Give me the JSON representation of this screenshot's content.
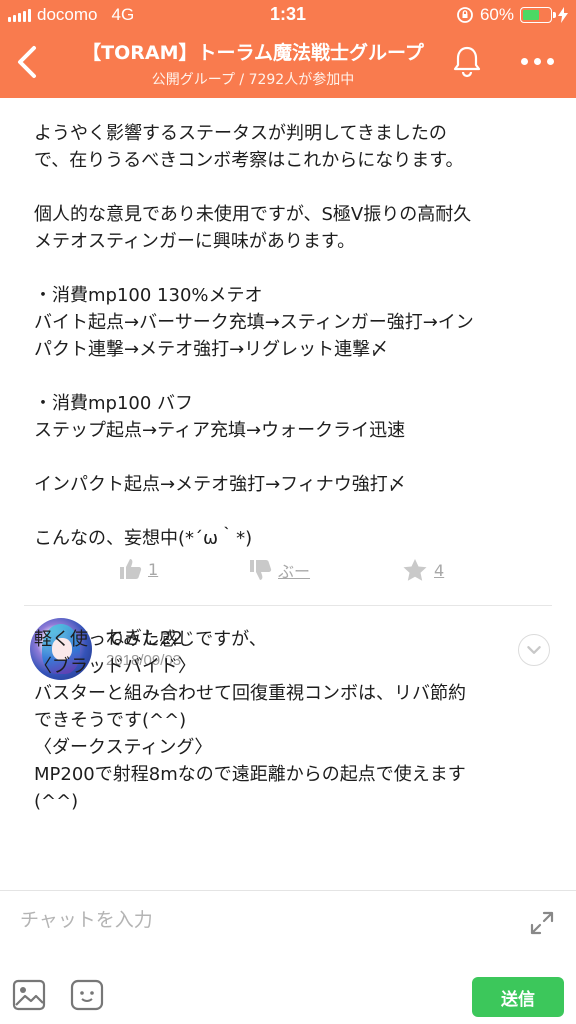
{
  "status_bar": {
    "carrier": "docomo",
    "network": "4G",
    "time": "1:31",
    "battery_percent": "60%",
    "battery_level": 0.6
  },
  "header": {
    "back_icon": "chevron-left-icon",
    "title": "【TORAM】トーラム魔法戦士グループ",
    "subtitle": "公開グループ / 7292人が参加中",
    "bell_icon": "bell-icon",
    "more_icon": "more-icon",
    "background_color": "#f97b4e"
  },
  "post": {
    "lines": [
      "ようやく影響するステータスが判明してきましたの",
      "で、在りうるべきコンボ考察はこれからになります。",
      "",
      "個人的な意見であり未使用ですが、S極V振りの高耐久",
      "メテオスティンガーに興味があります。",
      "",
      "・消費mp100 130%メテオ",
      "バイト起点→バーサーク充填→スティンガー強打→イン",
      "パクト連撃→メテオ強打→リグレット連撃〆",
      "",
      "・消費mp100 バフ",
      "ステップ起点→ティア充填→ウォークライ迅速",
      "",
      "インパクト起点→メテオ強打→フィナウ強打〆",
      "",
      "こんなの、妄想中(*´ω｀*)"
    ],
    "reactions": {
      "like_count": "1",
      "dislike_label": "ぶー",
      "star_count": "4"
    }
  },
  "comment": {
    "author": "ねぎし22",
    "date": "2018/09/03",
    "lines": [
      "軽く使ってみた感じですが、",
      "〈ブラッドバイド〉",
      "バスターと組み合わせて回復重視コンボは、リバ節約",
      "できそうです(^^)",
      "〈ダークスティング〉",
      "MP200で射程8mなので遠距離からの起点で使えます",
      "(^^)"
    ]
  },
  "composer": {
    "placeholder": "チャットを入力",
    "send_label": "送信",
    "send_color": "#3cc75b"
  }
}
